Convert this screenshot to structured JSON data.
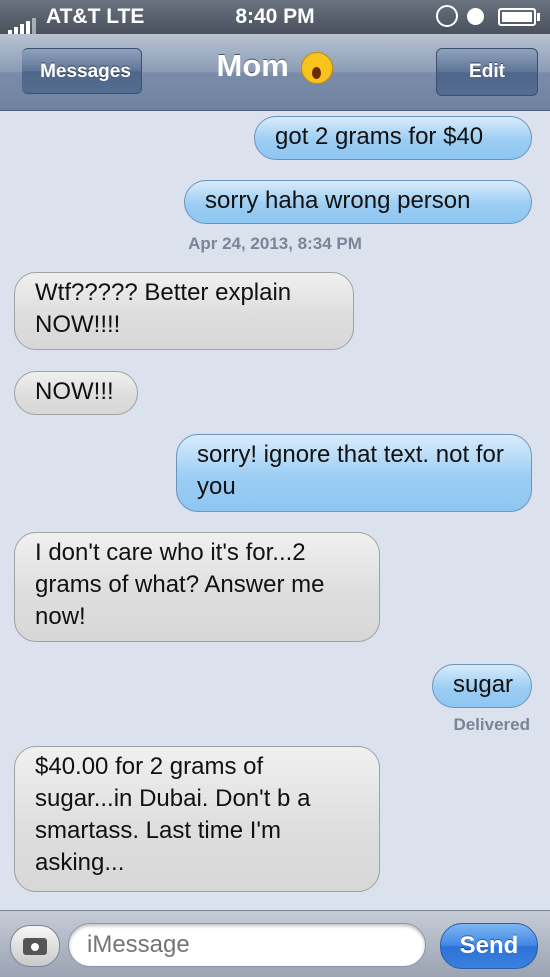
{
  "status_bar": {
    "carrier": "AT&T  LTE",
    "time": "8:40 PM",
    "icons": [
      "signal-icon",
      "orientation-lock-icon",
      "alarm-icon",
      "battery-icon"
    ]
  },
  "nav": {
    "back_label": "Messages",
    "title": "Mom",
    "title_emoji": "screaming-face-emoji",
    "edit_label": "Edit"
  },
  "messages": [
    {
      "direction": "out",
      "text": "got 2 grams for $40"
    },
    {
      "direction": "out",
      "text": "sorry haha wrong person"
    },
    {
      "direction": "in",
      "text": "Wtf????? Better explain NOW!!!!"
    },
    {
      "direction": "in",
      "text": "NOW!!!"
    },
    {
      "direction": "out",
      "text": "sorry! ignore that text. not for you"
    },
    {
      "direction": "in",
      "text": "I don't care who it's for...2 grams of what? Answer me now!"
    },
    {
      "direction": "out",
      "text": "sugar"
    },
    {
      "direction": "in",
      "text": "$40.00 for 2 grams of sugar...in Dubai. Don't b a smartass. Last time I'm asking..."
    }
  ],
  "timestamp": "Apr 24, 2013, 8:34 PM",
  "delivered_label": "Delivered",
  "input": {
    "placeholder": "iMessage",
    "send_label": "Send"
  },
  "colors": {
    "outgoing_bubble": "#9ccdf3",
    "incoming_bubble": "#dedede",
    "background": "#dbe2ed",
    "send_button": "#3f86e4"
  }
}
